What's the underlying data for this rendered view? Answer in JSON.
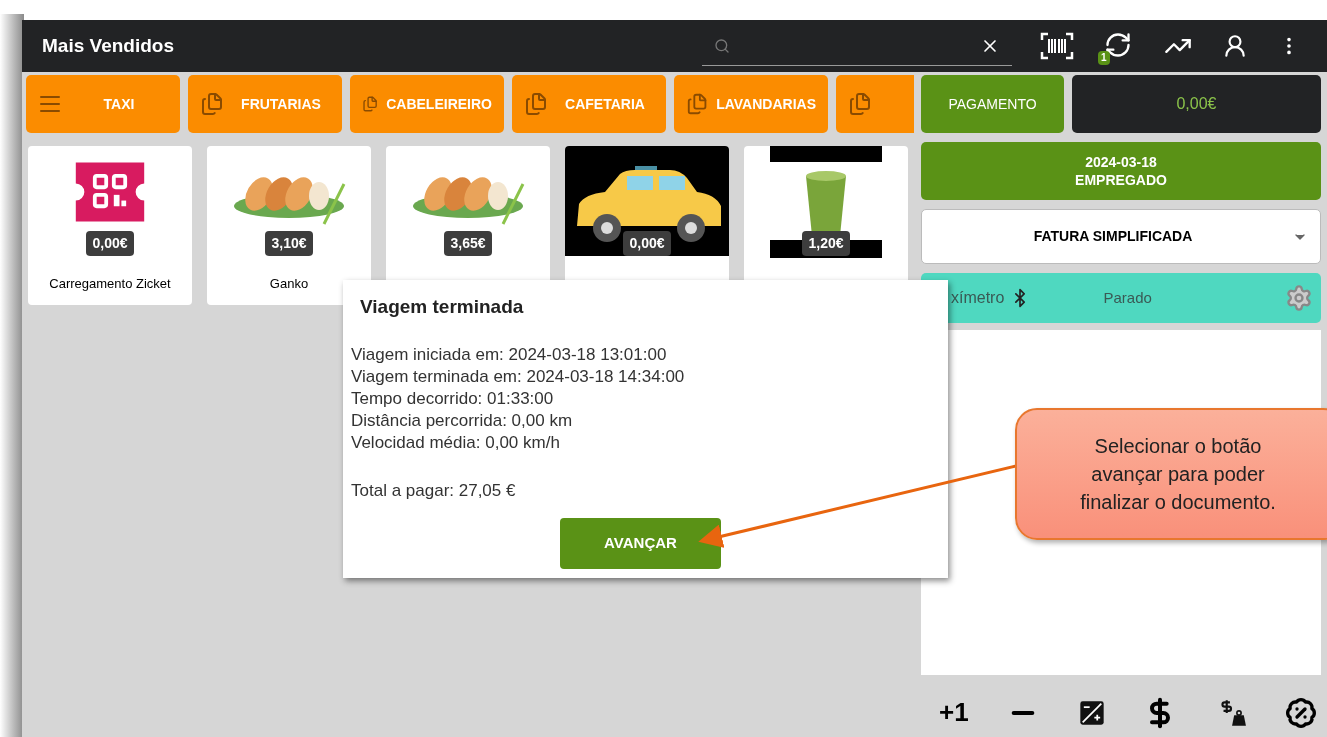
{
  "top_bar": {
    "title": "Mais Vendidos",
    "sync_badge": "1"
  },
  "categories": [
    {
      "kind": "list",
      "label": "TAXI"
    },
    {
      "kind": "copy",
      "label": "FRUTARIAS"
    },
    {
      "kind": "copy",
      "label": "CABELEIREIRO"
    },
    {
      "kind": "copy",
      "label": "CAFETARIA"
    },
    {
      "kind": "copy",
      "label": "LAVANDARIAS"
    },
    {
      "kind": "copy"
    }
  ],
  "products": [
    {
      "kind": "ticket",
      "price": "0,00€",
      "name": "Carregamento Zicket"
    },
    {
      "kind": "food",
      "price": "3,10€",
      "name": "Ganko"
    },
    {
      "kind": "food",
      "price": "3,65€"
    },
    {
      "kind": "taxi",
      "price": "0,00€"
    },
    {
      "kind": "drink",
      "price": "1,20€"
    }
  ],
  "payment": {
    "button": "PAGAMENTO",
    "total": "0,00€"
  },
  "session": {
    "date": "2024-03-18",
    "employee": "EMPREGADO"
  },
  "document_type": "FATURA SIMPLIFICADA",
  "taximeter": {
    "label": "xímetro",
    "status": "Parado"
  },
  "bottom_actions": [
    {
      "kind": "text",
      "label": "+1"
    },
    {
      "kind": "minus"
    },
    {
      "kind": "exposure"
    },
    {
      "kind": "dollar"
    },
    {
      "kind": "dollar-weight"
    },
    {
      "kind": "discount"
    }
  ],
  "dialog": {
    "title": "Viagem terminada",
    "lines": [
      "Viagem iniciada em: 2024-03-18 13:01:00",
      "Viagem terminada em: 2024-03-18 14:34:00",
      "Tempo decorrido: 01:33:00",
      "Distância percorrida: 0,00 km",
      "Velocidad média: 0,00 km/h"
    ],
    "total": "Total a pagar: 27,05 €",
    "button": "AVANÇAR"
  },
  "callout": {
    "text": "Selecionar o botão avançar para poder finalizar o documento."
  }
}
